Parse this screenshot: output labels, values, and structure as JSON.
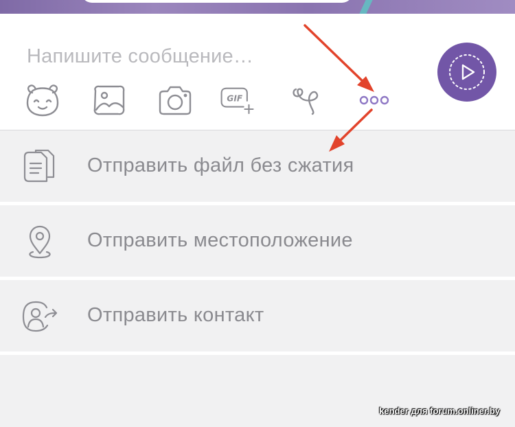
{
  "compose": {
    "placeholder": "Напишите сообщение…",
    "toolbar_icons": [
      "sticker-bear-icon",
      "gallery-icon",
      "camera-icon",
      "gif-icon",
      "doodle-icon",
      "more-icon"
    ],
    "send_button_icon": "video-message-play-icon"
  },
  "menu": {
    "items": [
      {
        "label": "Отправить файл без сжатия",
        "icon": "file-document-icon"
      },
      {
        "label": "Отправить местоположение",
        "icon": "location-pin-icon"
      },
      {
        "label": "Отправить контакт",
        "icon": "share-contact-icon"
      }
    ]
  },
  "watermark": "kender для forum.onliner.by",
  "colors": {
    "accent": "#7256a7",
    "icon_gray": "#8d8d93",
    "menu_background": "#f1f1f2",
    "annotation_arrow": "#e2432b",
    "more_dots": "#8e77c4"
  }
}
